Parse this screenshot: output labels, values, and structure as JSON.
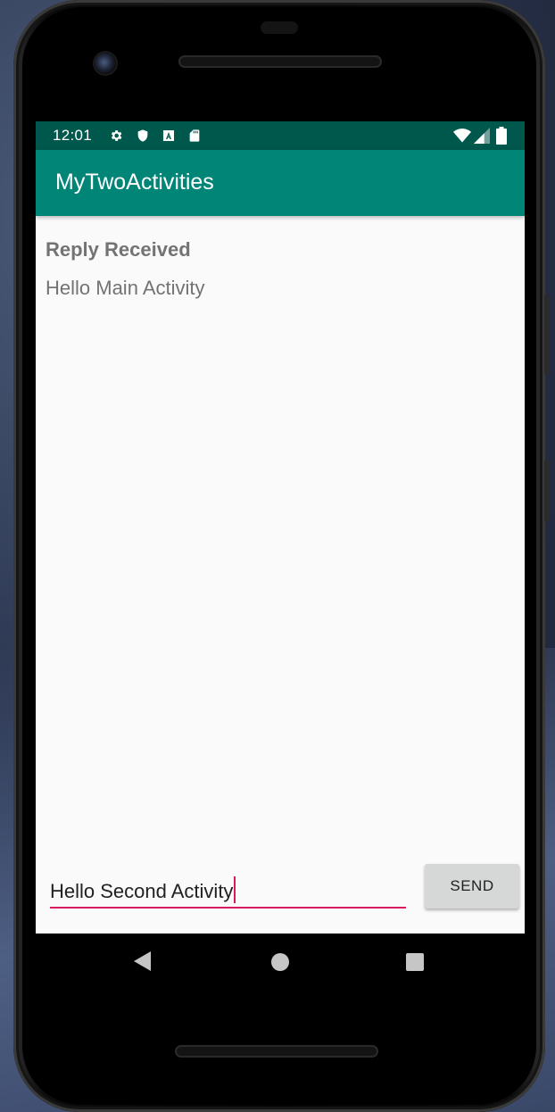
{
  "status_bar": {
    "time": "12:01",
    "left_icons": [
      "gear-icon",
      "shield-icon",
      "a-box-icon",
      "sd-card-icon"
    ],
    "right_icons": [
      "wifi-icon",
      "cell-signal-icon",
      "battery-icon"
    ],
    "color": "#00574b"
  },
  "app_bar": {
    "title": "MyTwoActivities",
    "color": "#008577"
  },
  "reply": {
    "header": "Reply Received",
    "message": "Hello Main Activity"
  },
  "composer": {
    "message_value": "Hello Second Activity",
    "send_label": "SEND",
    "accent": "#d81b60"
  },
  "nav_bar": {
    "buttons": [
      "back-icon",
      "home-icon",
      "recents-icon"
    ]
  }
}
